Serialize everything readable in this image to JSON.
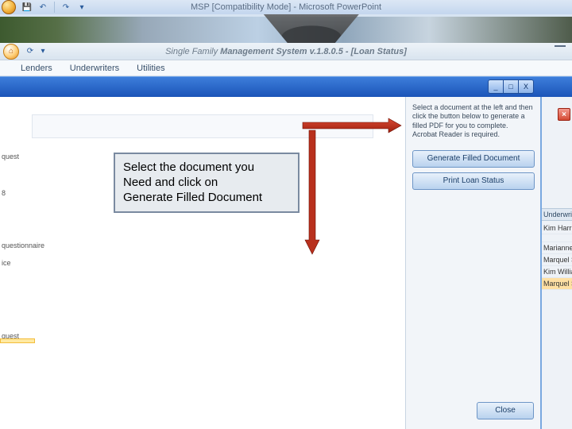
{
  "powerpoint": {
    "title": "MSP [Compatibility Mode] - Microsoft PowerPoint",
    "qat": {
      "save": "💾",
      "undo": "↶",
      "redo": "↷"
    }
  },
  "sfms": {
    "title_prefix": "Single Family ",
    "title_bold": "Management System v.1.8.0.5 - [Loan Status]",
    "menu": {
      "lenders": "Lenders",
      "underwriters": "Underwriters",
      "utilities": "Utilities"
    }
  },
  "left_items": {
    "quest": "quest",
    "eight": "8",
    "questionnaire": "questionnaire",
    "ice": "ice",
    "quest2": "quest"
  },
  "dialog": {
    "help_text": "Select a document at the left and then click the button below to generate a filled PDF for you to complete. Acrobat Reader is required.",
    "generate_btn": "Generate Filled Document",
    "print_btn": "Print Loan Status",
    "close_btn": "Close"
  },
  "callout": {
    "l1": "Select the document you",
    "l2": "Need and click on",
    "l3": "Generate Filled Document"
  },
  "peek": {
    "header": "Underwrite",
    "rows": [
      "Kim Harris",
      "Marianne F",
      "Marquel Sr",
      "Kim William",
      "Marquel Sr"
    ]
  },
  "winbtns": {
    "min": "_",
    "max": "□",
    "close": "X"
  }
}
